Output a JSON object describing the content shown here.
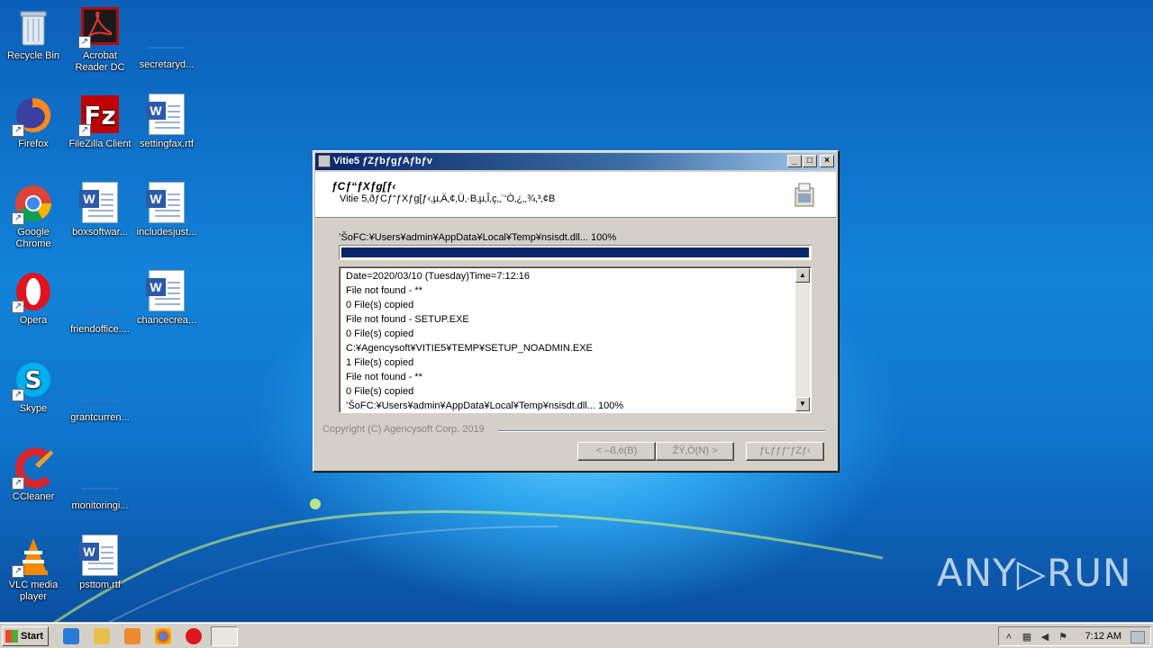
{
  "desktop": {
    "icons": [
      {
        "label": "Recycle Bin"
      },
      {
        "label": "Acrobat Reader DC"
      },
      {
        "label": "secretaryd..."
      },
      {
        "label": "Firefox"
      },
      {
        "label": "FileZilla Client"
      },
      {
        "label": "settingfax.rtf"
      },
      {
        "label": "Google Chrome"
      },
      {
        "label": "boxsoftwar..."
      },
      {
        "label": "includesjust..."
      },
      {
        "label": "Opera"
      },
      {
        "label": "friendoffice...."
      },
      {
        "label": "chancecrea..."
      },
      {
        "label": "Skype"
      },
      {
        "label": "grantcurren..."
      },
      {
        "label": "CCleaner"
      },
      {
        "label": "monitoringi..."
      },
      {
        "label": "VLC media player"
      },
      {
        "label": "psttom.rtf"
      }
    ]
  },
  "dialog": {
    "title": "Vitie5 ƒZƒbƒgƒAƒbƒv",
    "header_title": "ƒCƒ“ƒXƒg[ƒ‹",
    "header_subtitle": "Vitie 5‚ðƒCƒ“ƒXƒg[ƒ‹‚µ‚Ä‚¢‚Ü‚·B‚µ‚Î‚ç‚­‚¨‘Ò‚¿‚­‚¾‚³‚¢B",
    "status_path": "’ŠoFC:¥Users¥admin¥AppData¥Local¥Temp¥nsisdt.dll... 100%",
    "progress_percent": 100,
    "log_lines": [
      "Date=2020/03/10 (Tuesday)Time=7:12:16",
      "File not found - **",
      "0 File(s) copied",
      "File not found - SETUP.EXE",
      "0 File(s) copied",
      "C:¥Agencysoft¥VITIE5¥TEMP¥SETUP_NOADMIN.EXE",
      "1 File(s) copied",
      "File not found - **",
      "0 File(s) copied",
      "’ŠoFC:¥Users¥admin¥AppData¥Local¥Temp¥nsisdt.dll... 100%"
    ],
    "copyright": "Copyright (C) Agencysoft Corp. 2019",
    "back_button": "< –ß‚é(B)",
    "next_button": "ŽŸ‚Ö(N) >",
    "cancel_button": "ƒLƒƒƒ“ƒZƒ‹"
  },
  "taskbar": {
    "start_label": "Start",
    "clock": "7:12 AM"
  },
  "watermark": "ANY▷RUN"
}
